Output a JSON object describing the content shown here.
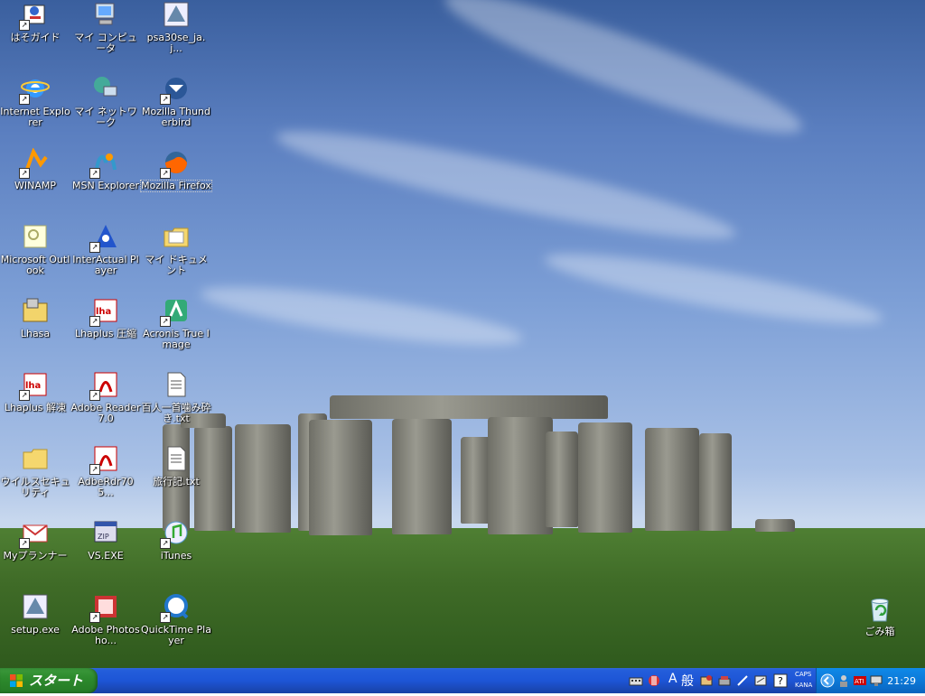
{
  "desktop": {
    "icons": [
      {
        "label": "はそガイド",
        "icon": "guide-icon"
      },
      {
        "label": "マイ コンピュータ",
        "icon": "my-computer-icon"
      },
      {
        "label": "psa30se_ja.j...",
        "icon": "setup-icon"
      },
      {
        "label": "Internet Explorer",
        "icon": "internet-explorer-icon"
      },
      {
        "label": "マイ ネットワーク",
        "icon": "my-network-icon"
      },
      {
        "label": "Mozilla Thunderbird",
        "icon": "thunderbird-icon"
      },
      {
        "label": "WINAMP",
        "icon": "winamp-icon"
      },
      {
        "label": "MSN Explorer",
        "icon": "msn-icon"
      },
      {
        "label": "Mozilla Firefox",
        "icon": "firefox-icon"
      },
      {
        "label": "Microsoft Outlook",
        "icon": "outlook-icon"
      },
      {
        "label": "InterActual Player",
        "icon": "interactual-icon"
      },
      {
        "label": "マイ ドキュメント",
        "icon": "my-documents-icon"
      },
      {
        "label": "Lhasa",
        "icon": "lhasa-icon"
      },
      {
        "label": "Lhaplus 圧縮",
        "icon": "lhaplus-icon"
      },
      {
        "label": "Acronis True Image",
        "icon": "acronis-icon"
      },
      {
        "label": "Lhaplus 解凍",
        "icon": "lhaplus-icon"
      },
      {
        "label": "Adobe Reader 7.0",
        "icon": "adobe-reader-icon"
      },
      {
        "label": "百人一首噛み砕き.txt",
        "icon": "text-file-icon"
      },
      {
        "label": "ウイルスセキュリティ",
        "icon": "folder-icon"
      },
      {
        "label": "AdbeRdr705...",
        "icon": "adobe-reader-icon"
      },
      {
        "label": "旅行記.txt",
        "icon": "text-file-icon"
      },
      {
        "label": "Myプランナー",
        "icon": "myplanner-icon"
      },
      {
        "label": "VS.EXE",
        "icon": "zip-exe-icon"
      },
      {
        "label": "iTunes",
        "icon": "itunes-icon"
      },
      {
        "label": "setup.exe",
        "icon": "setup-icon"
      },
      {
        "label": "Adobe Photosho...",
        "icon": "photoshop-icon"
      },
      {
        "label": "QuickTime Player",
        "icon": "quicktime-icon"
      }
    ],
    "recycle_bin": {
      "label": "ごみ箱",
      "icon": "recycle-bin-icon"
    }
  },
  "taskbar": {
    "start_label": "スタート",
    "ime_mode": "A",
    "ime_general": "般",
    "caps": "CAPS",
    "kana": "KANA",
    "clock": "21:29"
  }
}
